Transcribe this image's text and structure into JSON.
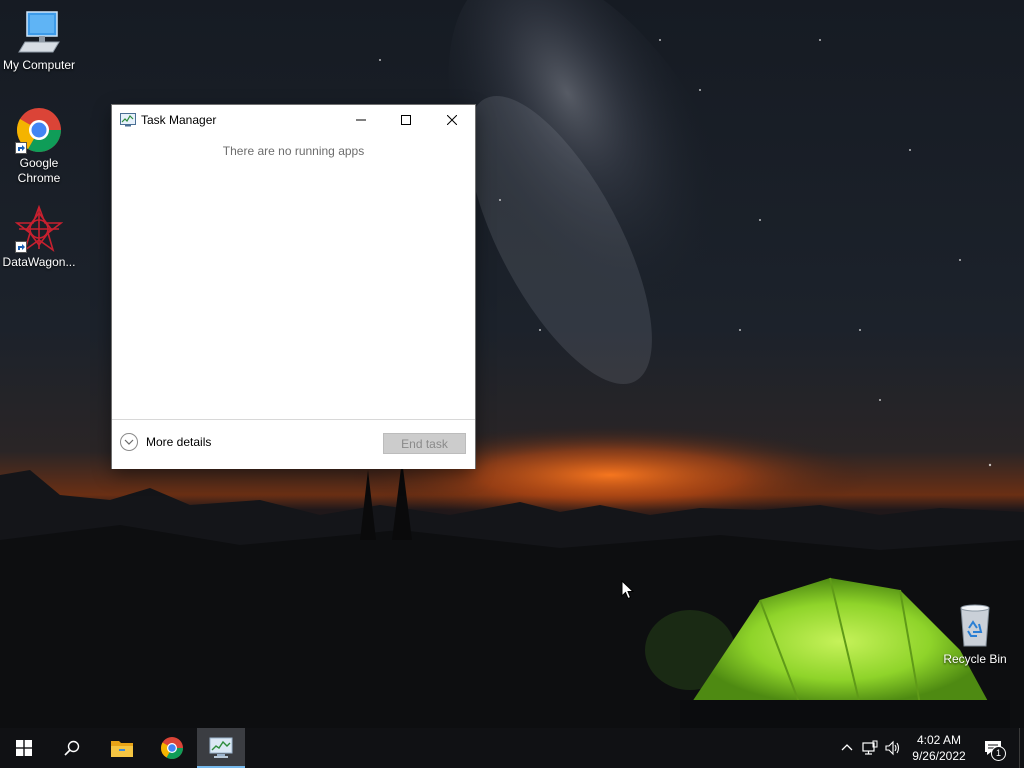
{
  "desktop": {
    "icons": [
      {
        "label": "My Computer",
        "icon": "computer-icon"
      },
      {
        "label": "Google Chrome",
        "icon": "chrome-icon",
        "shortcut": true
      },
      {
        "label": "DataWagon...",
        "icon": "datawagon-icon",
        "shortcut": true
      },
      {
        "label": "Recycle Bin",
        "icon": "recycle-bin-icon"
      }
    ]
  },
  "task_manager": {
    "title": "Task Manager",
    "empty_message": "There are no running apps",
    "more_details_label": "More details",
    "end_task_label": "End task",
    "end_task_enabled": false
  },
  "taskbar": {
    "buttons": [
      {
        "name": "start",
        "icon": "windows-logo-icon"
      },
      {
        "name": "search",
        "icon": "search-icon"
      },
      {
        "name": "file-explorer",
        "icon": "folder-icon"
      },
      {
        "name": "chrome",
        "icon": "chrome-icon"
      },
      {
        "name": "task-manager",
        "icon": "task-manager-icon",
        "active": true
      }
    ],
    "tray": {
      "time": "4:02 AM",
      "date": "9/26/2022",
      "notification_count": "1"
    }
  },
  "colors": {
    "taskbar_bg": "#101114",
    "active_underline": "#76b9ed",
    "tent_green": "#8fd42a",
    "sunset_orange": "#e8651c"
  }
}
